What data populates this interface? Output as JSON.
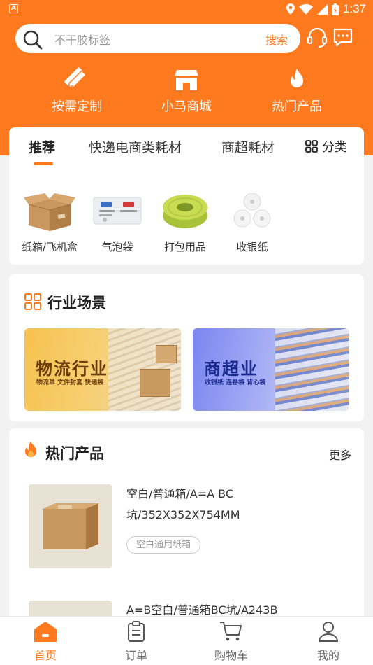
{
  "status_bar": {
    "time": "1:37",
    "app_badge": "A"
  },
  "search": {
    "placeholder": "不干胶标签",
    "button": "搜索"
  },
  "quick_entries": [
    {
      "label": "按需定制",
      "icon": "pencil-ruler-icon"
    },
    {
      "label": "小马商城",
      "icon": "store-icon"
    },
    {
      "label": "热门产品",
      "icon": "flame-icon"
    }
  ],
  "tabs": {
    "items": [
      "推荐",
      "快递电商类耗材",
      "商超耗材"
    ],
    "active": "推荐",
    "category_button": "分类"
  },
  "categories": [
    {
      "label": "纸箱/飞机盒"
    },
    {
      "label": "气泡袋"
    },
    {
      "label": "打包用品"
    },
    {
      "label": "收银纸"
    }
  ],
  "industry": {
    "title": "行业场景",
    "banners": [
      {
        "title": "物流行业",
        "subtitle": "物流单  文件封套  快递袋"
      },
      {
        "title": "商超业",
        "subtitle": "收银纸  连卷袋  背心袋"
      }
    ]
  },
  "hot": {
    "title": "热门产品",
    "more": "更多",
    "products": [
      {
        "name": "空白/普通箱/A=A BC坑/352X352X754MM",
        "tag": "空白通用纸箱"
      },
      {
        "name": "A=B空白/普通箱BC坑/A243B"
      }
    ]
  },
  "bottom_nav": {
    "items": [
      {
        "label": "首页",
        "icon": "home-icon"
      },
      {
        "label": "订单",
        "icon": "order-icon"
      },
      {
        "label": "购物车",
        "icon": "cart-icon"
      },
      {
        "label": "我的",
        "icon": "user-icon"
      }
    ],
    "active": "首页"
  },
  "colors": {
    "accent": "#ff7a1f",
    "background": "#f2f2f2"
  }
}
